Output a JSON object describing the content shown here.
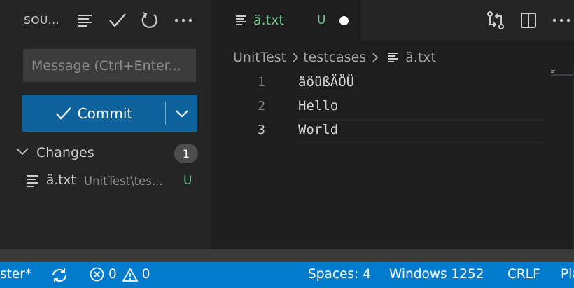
{
  "sidebar": {
    "title": "SOU...",
    "message_placeholder": "Message (Ctrl+Enter...",
    "commit_label": "Commit",
    "changes_label": "Changes",
    "changes_count": "1",
    "file": {
      "name": "ä.txt",
      "path": "UnitTest\\tes...",
      "status": "U"
    }
  },
  "editor": {
    "tab": {
      "label": "ä.txt",
      "status": "U"
    },
    "breadcrumb": [
      "UnitTest",
      "testcases",
      "ä.txt"
    ],
    "lines": [
      {
        "number": "1",
        "text": "äöüßÄÖÜ"
      },
      {
        "number": "2",
        "text": "Hello"
      },
      {
        "number": "3",
        "text": "World"
      }
    ]
  },
  "statusbar": {
    "branch": "ster*",
    "errors": "0",
    "warnings": "0",
    "spaces": "Spaces: 4",
    "encoding": "Windows 1252",
    "eol": "CRLF",
    "language": "Pla"
  },
  "colors": {
    "accent": "#007acc",
    "commit_button": "#0e639c",
    "untracked": "#73c991"
  },
  "icons": [
    "list-icon",
    "check-icon",
    "refresh-icon",
    "more-icon",
    "file-lines-icon",
    "compare-changes-icon",
    "split-editor-icon",
    "chevron-down-icon",
    "chevron-right-icon",
    "sync-icon",
    "error-icon",
    "warning-icon"
  ]
}
